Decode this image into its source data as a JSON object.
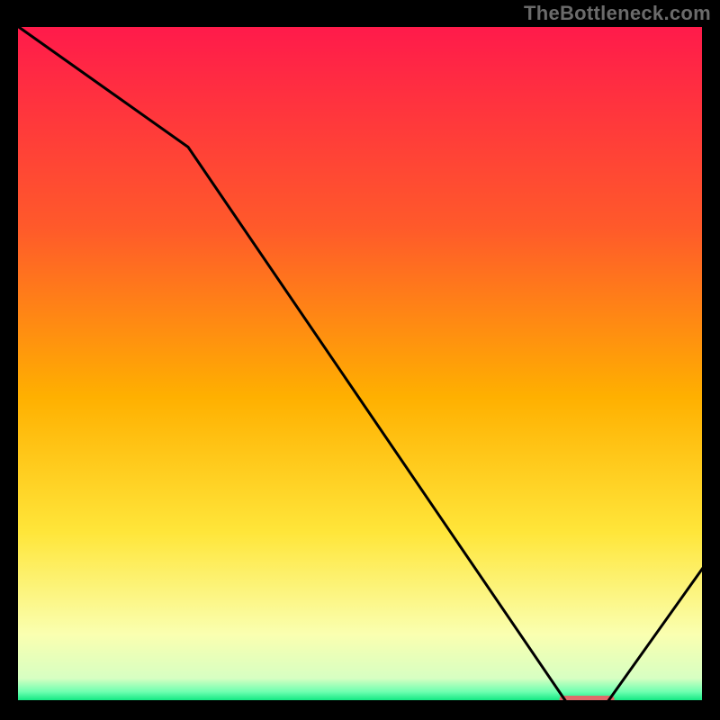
{
  "watermark": "TheBottleneck.com",
  "chart_data": {
    "type": "line",
    "title": "",
    "xlabel": "",
    "ylabel": "",
    "xlim": [
      0,
      100
    ],
    "ylim": [
      0,
      100
    ],
    "x": [
      0,
      25,
      80,
      86,
      100
    ],
    "values": [
      100,
      82,
      0,
      0,
      20
    ],
    "optimal_band": {
      "x_start": 79,
      "x_end": 87,
      "y": 0
    },
    "gradient_stops": [
      {
        "offset": 0.0,
        "color": "#ff1a4b"
      },
      {
        "offset": 0.3,
        "color": "#ff5a2a"
      },
      {
        "offset": 0.55,
        "color": "#ffb000"
      },
      {
        "offset": 0.75,
        "color": "#ffe63a"
      },
      {
        "offset": 0.9,
        "color": "#faffb0"
      },
      {
        "offset": 0.965,
        "color": "#d7ffc2"
      },
      {
        "offset": 0.985,
        "color": "#6dffb0"
      },
      {
        "offset": 1.0,
        "color": "#00e37a"
      }
    ]
  }
}
